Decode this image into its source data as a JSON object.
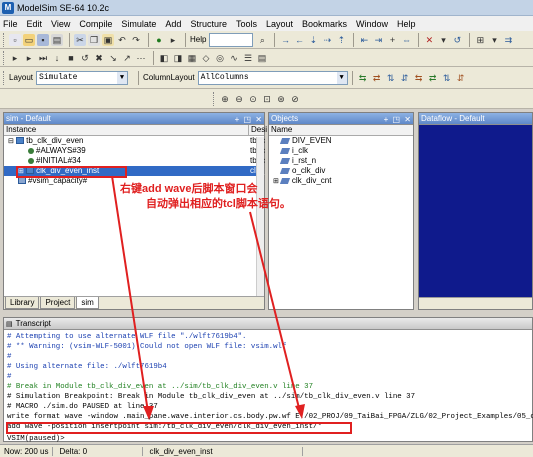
{
  "window": {
    "title": "ModelSim SE-64 10.2c"
  },
  "menu": [
    "File",
    "Edit",
    "View",
    "Compile",
    "Simulate",
    "Add",
    "Structure",
    "Tools",
    "Layout",
    "Bookmarks",
    "Window",
    "Help"
  ],
  "toolbar": {
    "help_label": "Help",
    "layout_label": "Layout",
    "layout_value": "Simulate",
    "column_layout_label": "ColumnLayout",
    "column_layout_value": "AllColumns"
  },
  "sim_pane": {
    "title": "sim - Default",
    "col_instance": "Instance",
    "col_design": "Desi",
    "items": [
      {
        "label": "tb_clk_div_even",
        "design": "tb_c"
      },
      {
        "label": "#ALWAYS#39",
        "design": "tb_c"
      },
      {
        "label": "#INITIAL#34",
        "design": "tb_c"
      },
      {
        "label": "clk_div_even_inst",
        "design": "clk_"
      },
      {
        "label": "#vsim_capacity#",
        "design": ""
      }
    ],
    "tabs": [
      "Library",
      "Project",
      "sim"
    ]
  },
  "objects_pane": {
    "title": "Objects",
    "col_name": "Name",
    "items": [
      "DIV_EVEN",
      "i_clk",
      "i_rst_n",
      "o_clk_div",
      "clk_div_cnt"
    ]
  },
  "dataflow_pane": {
    "title": "Dataflow - Default"
  },
  "annotation": {
    "line1": "右键add wave后脚本窗口会",
    "line2": "自动弹出相应的tcl脚本语句。",
    "color": "#e02020"
  },
  "transcript": {
    "title": "Transcript",
    "lines": [
      {
        "text": "#         Attempting to use alternate WLF file \"./wlft7619b4\".",
        "cls": "blue"
      },
      {
        "text": "# ** Warning: (vsim-WLF-5001) Could not open WLF file: vsim.wlf",
        "cls": "blue"
      },
      {
        "text": "#",
        "cls": "blue"
      },
      {
        "text": "#           Using alternate file: ./wlft7619b4",
        "cls": "blue"
      },
      {
        "text": "#",
        "cls": "blue"
      },
      {
        "text": "# Break in Module tb_clk_div_even at ../sim/tb_clk_div_even.v line 37",
        "cls": "green"
      },
      {
        "text": "# Simulation Breakpoint: Break in Module tb_clk_div_even at ../sim/tb_clk_div_even.v line 37",
        "cls": ""
      },
      {
        "text": "# MACRO ./sim.do PAUSED at line 37",
        "cls": ""
      },
      {
        "text": "write format wave -window .main_pane.wave.interior.cs.body.pw.wf E:/02_PROJ/09_TaiBai_FPGA/ZLG/02_Project_Examples/05_cl",
        "cls": ""
      },
      {
        "text": "add wave -position insertpoint sim:/tb_clk_div_even/clk_div_even_inst/*",
        "cls": ""
      }
    ],
    "prompt": "VSIM(paused)>"
  },
  "statusbar": {
    "now": "Now: 200 us",
    "delta": "Delta: 0",
    "instance": "clk_div_even_inst"
  }
}
